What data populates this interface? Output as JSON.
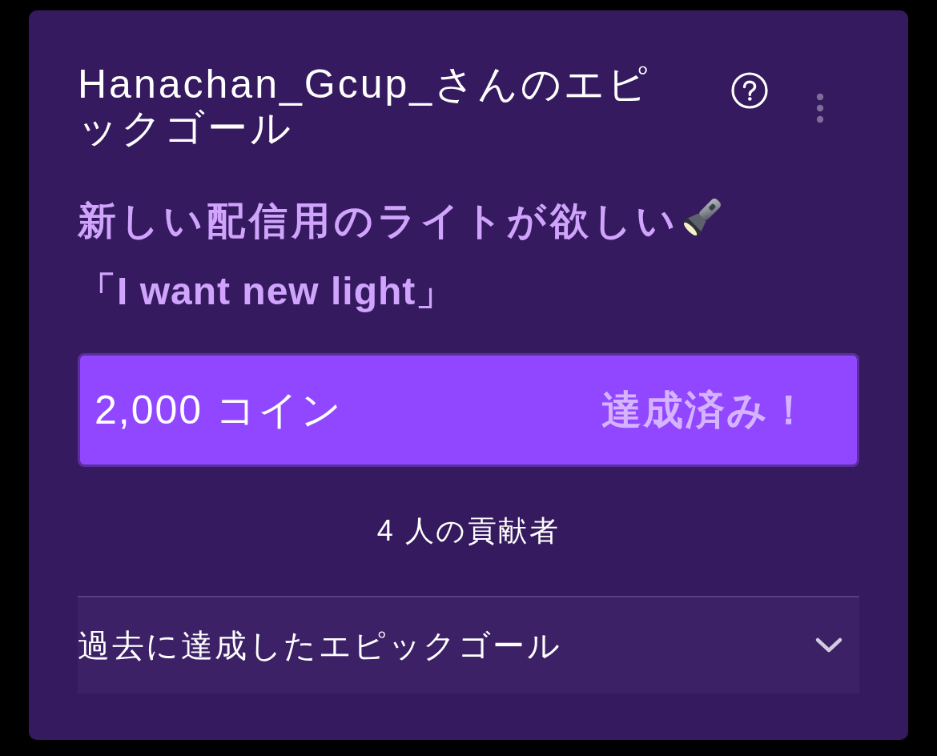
{
  "header": {
    "title": "Hanachan_Gcup_さんのエピックゴール"
  },
  "goal": {
    "title": "新しい配信用のライトが欲しい",
    "subtitle": "「I want new light」"
  },
  "progress": {
    "amount": "2,000 コイン",
    "status": "達成済み！",
    "level": 1
  },
  "contributors": "4 人の貢献者",
  "past_goals": {
    "label": "過去に達成したエピックゴール",
    "expanded": false
  }
}
